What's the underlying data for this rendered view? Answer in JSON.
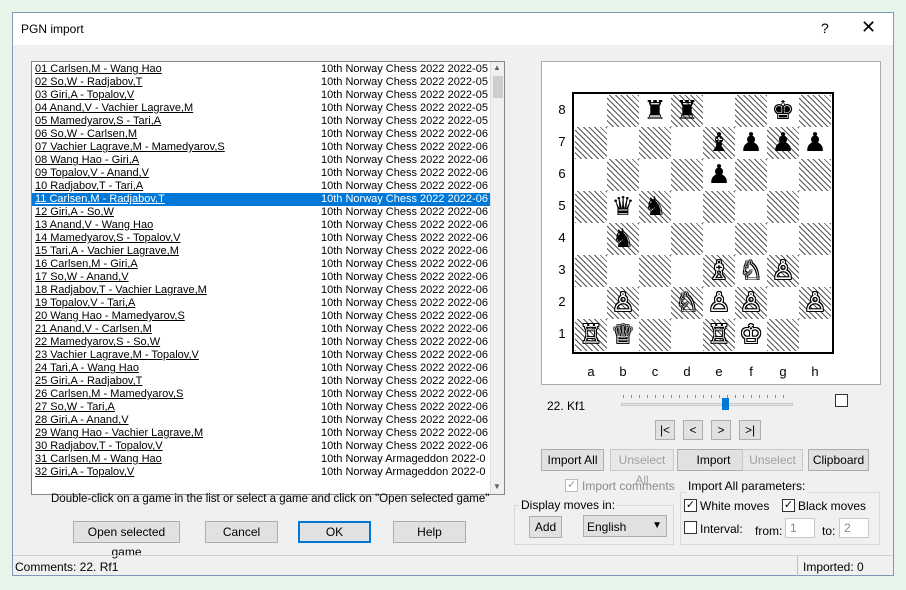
{
  "window": {
    "title": "PGN import",
    "help_glyph": "?",
    "close_glyph": "✕"
  },
  "games": [
    {
      "game": "01 Carlsen,M - Wang Hao",
      "event": "10th Norway Chess 2022  2022-05"
    },
    {
      "game": "02 So,W - Radjabov,T",
      "event": "10th Norway Chess 2022  2022-05"
    },
    {
      "game": "03 Giri,A - Topalov,V",
      "event": "10th Norway Chess 2022  2022-05"
    },
    {
      "game": "04 Anand,V - Vachier Lagrave,M",
      "event": "10th Norway Chess 2022  2022-05"
    },
    {
      "game": "05 Mamedyarov,S - Tari,A",
      "event": "10th Norway Chess 2022  2022-05"
    },
    {
      "game": "06 So,W - Carlsen,M",
      "event": "10th Norway Chess 2022  2022-06"
    },
    {
      "game": "07 Vachier Lagrave,M - Mamedyarov,S",
      "event": "10th Norway Chess 2022  2022-06"
    },
    {
      "game": "08 Wang Hao - Giri,A",
      "event": "10th Norway Chess 2022  2022-06"
    },
    {
      "game": "09 Topalov,V - Anand,V",
      "event": "10th Norway Chess 2022  2022-06"
    },
    {
      "game": "10 Radjabov,T - Tari,A",
      "event": "10th Norway Chess 2022  2022-06"
    },
    {
      "game": "11 Carlsen,M - Radjabov,T",
      "event": "10th Norway Chess 2022  2022-06"
    },
    {
      "game": "12 Giri,A - So,W",
      "event": "10th Norway Chess 2022  2022-06"
    },
    {
      "game": "13 Anand,V - Wang Hao",
      "event": "10th Norway Chess 2022  2022-06"
    },
    {
      "game": "14 Mamedyarov,S - Topalov,V",
      "event": "10th Norway Chess 2022  2022-06"
    },
    {
      "game": "15 Tari,A - Vachier Lagrave,M",
      "event": "10th Norway Chess 2022  2022-06"
    },
    {
      "game": "16 Carlsen,M - Giri,A",
      "event": "10th Norway Chess 2022  2022-06"
    },
    {
      "game": "17 So,W - Anand,V",
      "event": "10th Norway Chess 2022  2022-06"
    },
    {
      "game": "18 Radjabov,T - Vachier Lagrave,M",
      "event": "10th Norway Chess 2022  2022-06"
    },
    {
      "game": "19 Topalov,V - Tari,A",
      "event": "10th Norway Chess 2022  2022-06"
    },
    {
      "game": "20 Wang Hao - Mamedyarov,S",
      "event": "10th Norway Chess 2022  2022-06"
    },
    {
      "game": "21 Anand,V - Carlsen,M",
      "event": "10th Norway Chess 2022  2022-06"
    },
    {
      "game": "22 Mamedyarov,S - So,W",
      "event": "10th Norway Chess 2022  2022-06"
    },
    {
      "game": "23 Vachier Lagrave,M - Topalov,V",
      "event": "10th Norway Chess 2022  2022-06"
    },
    {
      "game": "24 Tari,A - Wang Hao",
      "event": "10th Norway Chess 2022  2022-06"
    },
    {
      "game": "25 Giri,A - Radjabov,T",
      "event": "10th Norway Chess 2022  2022-06"
    },
    {
      "game": "26 Carlsen,M - Mamedyarov,S",
      "event": "10th Norway Chess 2022  2022-06"
    },
    {
      "game": "27 So,W - Tari,A",
      "event": "10th Norway Chess 2022  2022-06"
    },
    {
      "game": "28 Giri,A - Anand,V",
      "event": "10th Norway Chess 2022  2022-06"
    },
    {
      "game": "29 Wang Hao - Vachier Lagrave,M",
      "event": "10th Norway Chess 2022  2022-06"
    },
    {
      "game": "30 Radjabov,T - Topalov,V",
      "event": "10th Norway Chess 2022  2022-06"
    },
    {
      "game": "31 Carlsen,M - Wang Hao",
      "event": "10th Norway Armageddon  2022-0"
    },
    {
      "game": "32 Giri,A - Topalov,V",
      "event": "10th Norway Armageddon  2022-0"
    }
  ],
  "selected_index": 10,
  "hint": "Double-click on a game in the list or select a game and click on  \"Open selected game\"",
  "buttons": {
    "open_selected": "Open selected game",
    "cancel": "Cancel",
    "ok": "OK",
    "help": "Help",
    "import_all": "Import All",
    "unselect_all": "Unselect All",
    "import": "Import",
    "unselect": "Unselect",
    "clipboard": "Clipboard",
    "add": "Add"
  },
  "nav": {
    "first": "|<",
    "prev": "<",
    "next": ">",
    "last": ">|"
  },
  "board": {
    "ranks": [
      "8",
      "7",
      "6",
      "5",
      "4",
      "3",
      "2",
      "1"
    ],
    "files": [
      "a",
      "b",
      "c",
      "d",
      "e",
      "f",
      "g",
      "h"
    ],
    "pieces": [
      {
        "sq": "c8",
        "glyph": "♜",
        "color": "b"
      },
      {
        "sq": "d8",
        "glyph": "♜",
        "color": "b"
      },
      {
        "sq": "g8",
        "glyph": "♚",
        "color": "b"
      },
      {
        "sq": "e7",
        "glyph": "♝",
        "color": "b"
      },
      {
        "sq": "f7",
        "glyph": "♟",
        "color": "b"
      },
      {
        "sq": "g7",
        "glyph": "♟",
        "color": "b"
      },
      {
        "sq": "h7",
        "glyph": "♟",
        "color": "b"
      },
      {
        "sq": "e6",
        "glyph": "♟",
        "color": "b"
      },
      {
        "sq": "b5",
        "glyph": "♛",
        "color": "b"
      },
      {
        "sq": "c5",
        "glyph": "♞",
        "color": "b"
      },
      {
        "sq": "b4",
        "glyph": "♞",
        "color": "b"
      },
      {
        "sq": "e3",
        "glyph": "♗",
        "color": "w"
      },
      {
        "sq": "f3",
        "glyph": "♘",
        "color": "w"
      },
      {
        "sq": "g3",
        "glyph": "♙",
        "color": "w"
      },
      {
        "sq": "b2",
        "glyph": "♙",
        "color": "w"
      },
      {
        "sq": "d2",
        "glyph": "♘",
        "color": "w"
      },
      {
        "sq": "e2",
        "glyph": "♙",
        "color": "w"
      },
      {
        "sq": "f2",
        "glyph": "♙",
        "color": "w"
      },
      {
        "sq": "h2",
        "glyph": "♙",
        "color": "w"
      },
      {
        "sq": "a1",
        "glyph": "♖",
        "color": "w"
      },
      {
        "sq": "b1",
        "glyph": "♕",
        "color": "w"
      },
      {
        "sq": "e1",
        "glyph": "♖",
        "color": "w"
      },
      {
        "sq": "f1",
        "glyph": "♔",
        "color": "w"
      }
    ]
  },
  "move": {
    "label": "22. Kf1",
    "slider_fraction": 0.62
  },
  "options": {
    "import_comments": "Import comments",
    "display_moves_in": "Display moves in:",
    "language": "English",
    "import_all_params": "Import All parameters:",
    "white_moves": "White moves",
    "black_moves": "Black moves",
    "interval": "Interval:",
    "from_label": "from:",
    "from_value": "1",
    "to_label": "to:",
    "to_value": "2"
  },
  "status": {
    "comments": "Comments: 22. Rf1",
    "imported": "Imported: 0"
  },
  "colors": {
    "selection": "#0078d7",
    "window_bg": "#f0f0f0"
  }
}
